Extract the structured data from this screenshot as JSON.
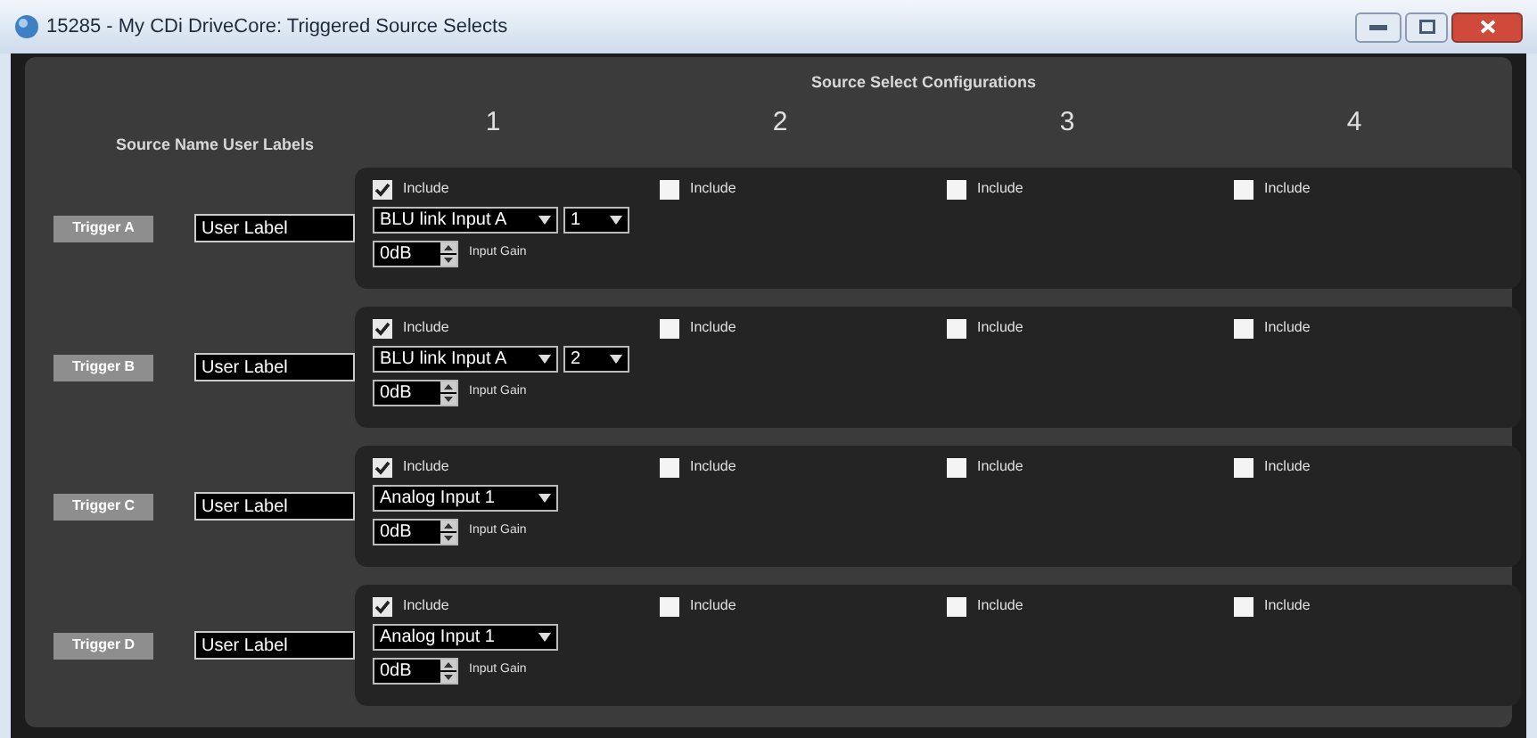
{
  "window": {
    "title": "15285 - My CDi DriveCore: Triggered Source Selects"
  },
  "header": {
    "title": "Source Select Configurations",
    "columns": [
      "1",
      "2",
      "3",
      "4"
    ],
    "labels_heading": "Source Name User Labels"
  },
  "rows": [
    {
      "trigger": "Trigger A",
      "user_label": "User Label",
      "configs": [
        {
          "label": "Include",
          "checked": true,
          "source": "BLU link Input A",
          "channel": "1",
          "gain": "0dB",
          "gain_label": "Input Gain"
        },
        {
          "label": "Include",
          "checked": false
        },
        {
          "label": "Include",
          "checked": false
        },
        {
          "label": "Include",
          "checked": false
        }
      ]
    },
    {
      "trigger": "Trigger B",
      "user_label": "User Label",
      "configs": [
        {
          "label": "Include",
          "checked": true,
          "source": "BLU link Input A",
          "channel": "2",
          "gain": "0dB",
          "gain_label": "Input Gain"
        },
        {
          "label": "Include",
          "checked": false
        },
        {
          "label": "Include",
          "checked": false
        },
        {
          "label": "Include",
          "checked": false
        }
      ]
    },
    {
      "trigger": "Trigger C",
      "user_label": "User Label",
      "configs": [
        {
          "label": "Include",
          "checked": true,
          "source": "Analog Input 1",
          "gain": "0dB",
          "gain_label": "Input Gain"
        },
        {
          "label": "Include",
          "checked": false
        },
        {
          "label": "Include",
          "checked": false
        },
        {
          "label": "Include",
          "checked": false
        }
      ]
    },
    {
      "trigger": "Trigger D",
      "user_label": "User Label",
      "configs": [
        {
          "label": "Include",
          "checked": true,
          "source": "Analog Input 1",
          "gain": "0dB",
          "gain_label": "Input Gain"
        },
        {
          "label": "Include",
          "checked": false
        },
        {
          "label": "Include",
          "checked": false
        },
        {
          "label": "Include",
          "checked": false
        }
      ]
    }
  ]
}
